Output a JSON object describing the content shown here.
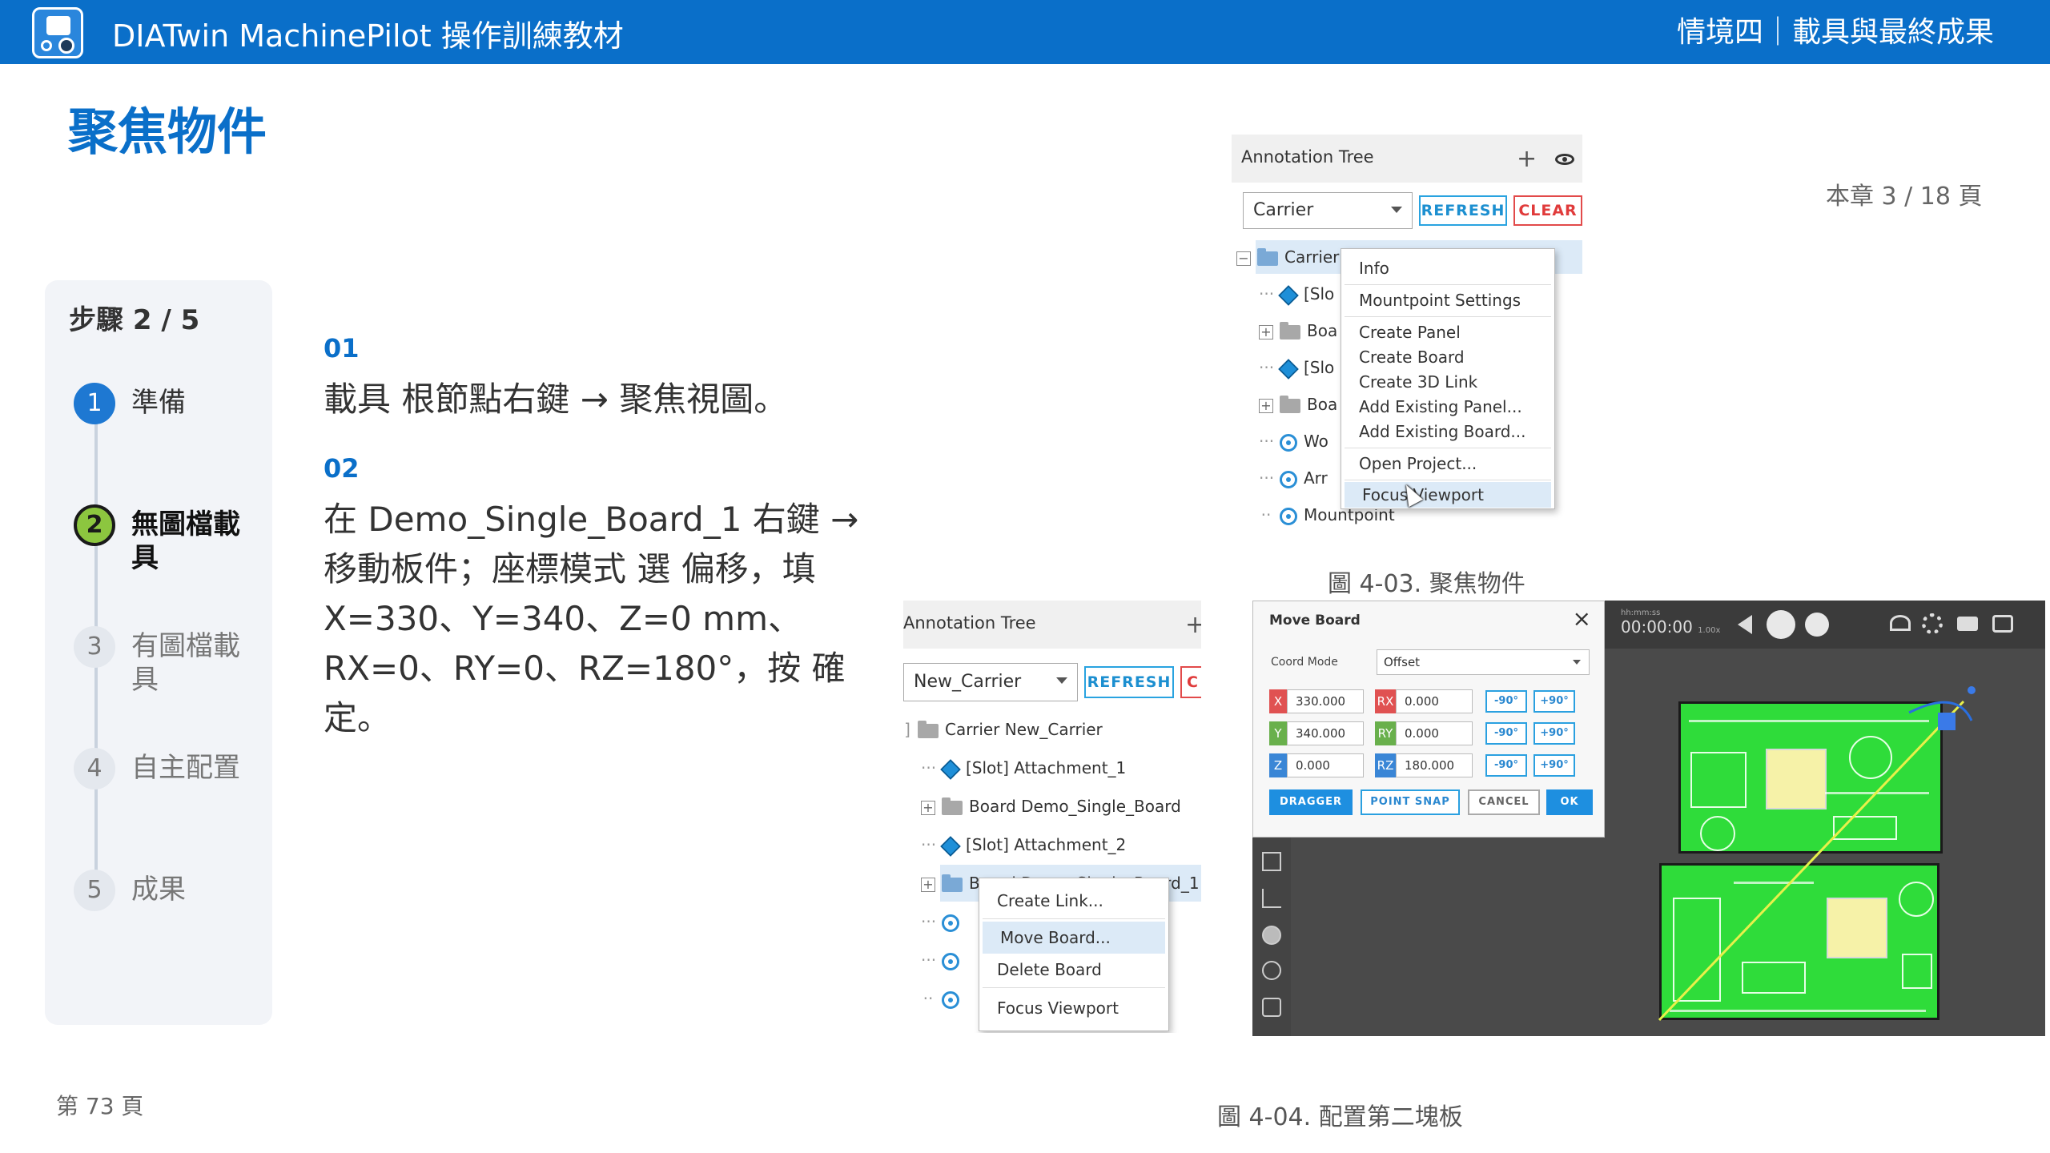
{
  "header": {
    "app_title": "DIATwin MachinePilot 操作訓練教材",
    "chapter": "情境四｜載具與最終成果"
  },
  "page": {
    "title": "聚焦物件",
    "chapter_page": "本章 3 / 18 頁",
    "page_number": "第 73 頁"
  },
  "steps": {
    "heading": "步驟 2 / 5",
    "items": [
      {
        "num": "1",
        "label": "準備",
        "state": "done"
      },
      {
        "num": "2",
        "label": "無圖檔載具",
        "state": "active"
      },
      {
        "num": "3",
        "label": "有圖檔載具",
        "state": "todo"
      },
      {
        "num": "4",
        "label": "自主配置",
        "state": "todo"
      },
      {
        "num": "5",
        "label": "成果",
        "state": "todo"
      }
    ]
  },
  "instructions": [
    {
      "num": "01",
      "text": "載具 根節點右鍵 → 聚焦視圖。"
    },
    {
      "num": "02",
      "text": "在 Demo_Single_Board_1 右鍵 → 移動板件；座標模式 選 偏移，填 X=330、Y=340、Z=0 mm、RX=0、RY=0、RZ=180°，按 確定。"
    }
  ],
  "figure1": {
    "caption": "圖 4-03. 聚焦物件",
    "panel_title": "Annotation Tree",
    "select_value": "Carrier",
    "refresh_label": "REFRESH",
    "clear_label": "CLEAR",
    "tree_rows": [
      "Carrier",
      "[Slo",
      "Boa",
      "[Slo",
      "Boa",
      "Wo",
      "Arr",
      "Mountpoint"
    ],
    "menu_items": [
      "Info",
      "Mountpoint Settings",
      "Create Panel",
      "Create Board",
      "Create 3D Link",
      "Add Existing Panel...",
      "Add Existing Board...",
      "Open Project...",
      "Focus Viewport"
    ]
  },
  "figure2": {
    "caption": "圖 4-04. 配置第二塊板",
    "panel_title": "Annotation Tree",
    "select_value": "New_Carrier",
    "refresh_label": "REFRESH",
    "clear_label": "C",
    "tree_rows": [
      "Carrier  New_Carrier",
      "[Slot] Attachment_1",
      "Board  Demo_Single_Board",
      "[Slot] Attachment_2",
      "Board  Demo_Single_Board_1"
    ],
    "menu_items": [
      "Create Link...",
      "Move Board...",
      "Delete Board",
      "Focus Viewport"
    ]
  },
  "move_board": {
    "title": "Move Board",
    "coord_mode_label": "Coord Mode",
    "coord_mode_value": "Offset",
    "x": "330.000",
    "y": "340.000",
    "z": "0.000",
    "rx": "0.000",
    "ry": "0.000",
    "rz": "180.000",
    "axis_labels": [
      "X",
      "Y",
      "Z",
      "RX",
      "RY",
      "RZ"
    ],
    "minus90": "-90°",
    "plus90": "+90°",
    "buttons": [
      "DRAGGER",
      "POINT SNAP",
      "CANCEL",
      "OK"
    ]
  },
  "viewport": {
    "timecode_label": "hh:mm:ss",
    "timecode": "00:00:00",
    "speed": "1.00x"
  },
  "colors": {
    "brand": "#0a6fc9",
    "active_step": "#8cc63f",
    "board_green": "#2fdc3a"
  }
}
